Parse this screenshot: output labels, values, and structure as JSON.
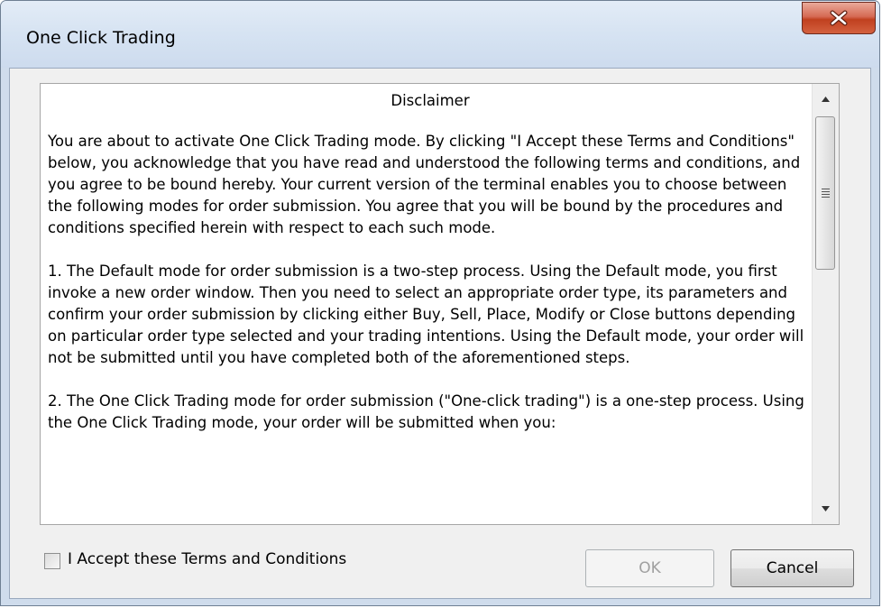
{
  "window": {
    "title": "One Click Trading"
  },
  "disclaimer": {
    "heading": "Disclaimer",
    "paragraphs": [
      "You are about to activate One Click Trading mode. By clicking \"I Accept these Terms and Conditions\" below, you acknowledge that you have read and understood the following terms and conditions, and you agree to be bound hereby. Your current version of the terminal enables you to choose between the following modes for order submission. You agree that you will be bound by the procedures and conditions specified herein with respect to each such mode.",
      "1. The Default mode for order submission is a two-step process. Using the Default mode, you first invoke a new order window. Then you need to select an appropriate order type, its parameters and confirm your order submission by clicking either Buy, Sell, Place, Modify or Close buttons depending on particular order type selected and your trading intentions. Using the Default mode, your order will not be submitted until you have completed both of the aforementioned steps.",
      "2. The One Click Trading mode for order submission (\"One-click trading\") is a one-step process. Using the One Click Trading mode, your order will be submitted when you:"
    ]
  },
  "accept": {
    "label": "I Accept these Terms and Conditions",
    "checked": false
  },
  "buttons": {
    "ok": "OK",
    "cancel": "Cancel"
  },
  "icons": {
    "close": "close-icon",
    "scroll_up": "arrow-up-icon",
    "scroll_down": "arrow-down-icon",
    "thumb_grip": "grip-icon"
  },
  "colors": {
    "close_button": "#c7462a",
    "dialog_bg": "#f0f0f0",
    "frame": "#cfdcec"
  }
}
